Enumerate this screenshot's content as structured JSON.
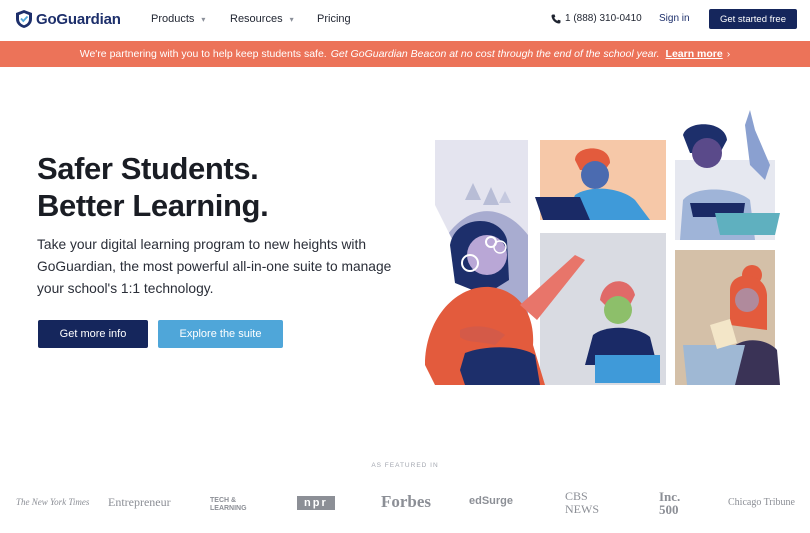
{
  "nav": {
    "brand": "GoGuardian",
    "items": [
      {
        "label": "Products",
        "has_dropdown": true
      },
      {
        "label": "Resources",
        "has_dropdown": true
      },
      {
        "label": "Pricing",
        "has_dropdown": false
      }
    ],
    "phone": "1 (888) 310-0410",
    "signin": "Sign in",
    "cta": "Get started free"
  },
  "banner": {
    "text": "We're partnering with you to help keep students safe.",
    "emphasis": "Get GoGuardian Beacon at no cost through the end of the school year.",
    "link": "Learn more",
    "arrow": "›"
  },
  "hero": {
    "title_line1": "Safer Students.",
    "title_line2": "Better Learning.",
    "subtitle": "Take your digital learning program to new heights with GoGuardian, the most powerful all-in-one suite to manage your school's 1:1 technology.",
    "primary_button": "Get more info",
    "secondary_button": "Explore the suite"
  },
  "featured": {
    "label": "AS FEATURED IN",
    "publications": [
      "The New York Times",
      "Entrepreneur",
      "TECH & LEARNING",
      "npr",
      "Forbes",
      "edSurge",
      "CBS NEWS",
      "Inc. 500",
      "Chicago Tribune"
    ]
  },
  "colors": {
    "navy": "#15265c",
    "banner": "#ec7359",
    "light_blue": "#4fa6d9"
  }
}
